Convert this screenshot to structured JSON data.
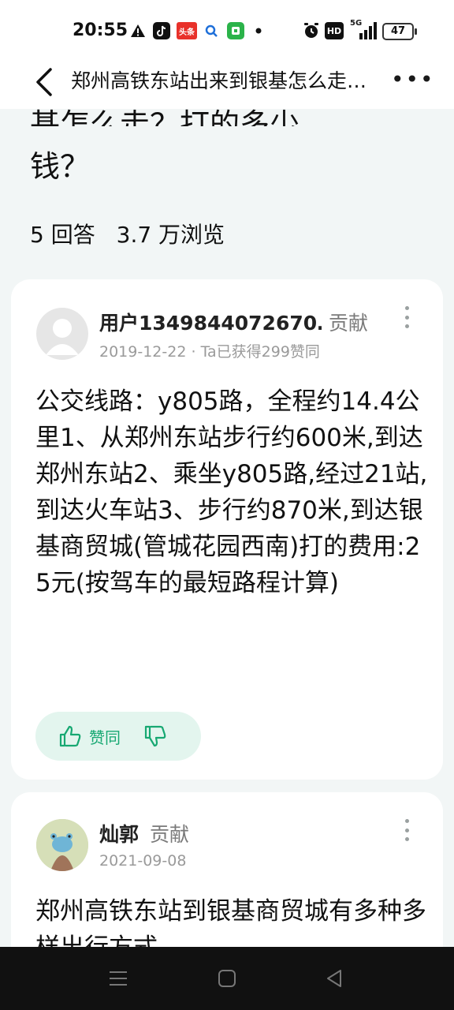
{
  "status_bar": {
    "time": "20:55",
    "icons": [
      "alert-icon",
      "tiktok-icon",
      "toutiao-icon",
      "search-app-icon",
      "app-icon",
      "dot-icon"
    ],
    "toutiao_label": "头条",
    "right_icons": [
      "alarm-icon",
      "hd-icon",
      "5g-signal-icon",
      "battery-icon"
    ],
    "hd_label": "HD",
    "network_label": "5G",
    "battery": "47"
  },
  "header": {
    "title": "郑州高铁东站出来到银基怎么走？打的多少钱？",
    "back_icon": "chevron-left-icon",
    "more_label": "•••"
  },
  "question": {
    "title_partial": "基怎么走？打的多少",
    "title_last_line": "钱？",
    "answers_count": "5 回答",
    "views": "3.7 万浏览"
  },
  "answers": [
    {
      "user": "用户1349844072670…",
      "badge": "贡献",
      "date": "2019-12-22",
      "sep": "·",
      "likes_info": "Ta已获得299赞同",
      "text": "公交线路：y805路，全程约14.4公里1、从郑州东站步行约600米,到达郑州东站2、乘坐y805路,经过21站,到达火车站3、步行约870米,到达银基商贸城(管城花园西南)打的费用:25元(按驾车的最短路程计算)",
      "vote_label": "赞同"
    },
    {
      "user": "灿郭",
      "badge": "贡献",
      "date": "2021-09-08",
      "text": "郑州高铁东站到银基商贸城有多种多样出行方式"
    }
  ],
  "colors": {
    "accent": "#17a872",
    "background": "#f2f6f6",
    "nav_bar": "#111111"
  }
}
